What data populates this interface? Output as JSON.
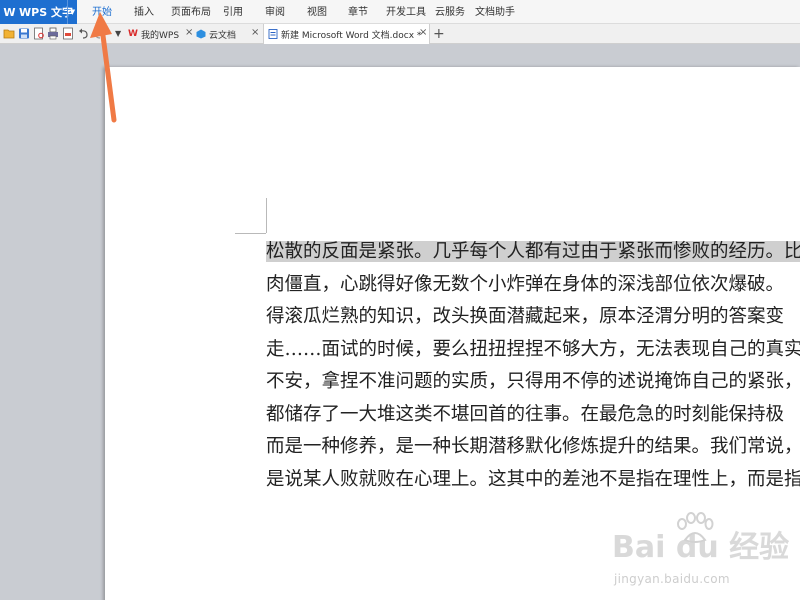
{
  "app": {
    "title": "WPS 文字",
    "logo": "W"
  },
  "menu": {
    "items": [
      "开始",
      "插入",
      "页面布局",
      "引用",
      "审阅",
      "视图",
      "章节",
      "开发工具",
      "云服务",
      "文档助手"
    ],
    "active_index": 0
  },
  "quick_access_icons": [
    "open-icon",
    "save-icon",
    "print-preview-icon",
    "print-icon",
    "export-pdf-icon",
    "undo-icon",
    "redo-icon",
    "dropdown-icon"
  ],
  "tabs": [
    {
      "label": "我的WPS",
      "icon": "wps-icon"
    },
    {
      "label": "云文档",
      "icon": "cloud-doc-icon"
    },
    {
      "label": "新建 Microsoft Word 文档.docx *",
      "icon": "word-doc-icon",
      "active": true
    }
  ],
  "new_tab_symbol": "+",
  "close_symbol": "×",
  "document": {
    "lines": [
      "松散的反面是紧张。几乎每个人都有过由于紧张而惨败的经历。比",
      "肉僵直，心跳得好像无数个小炸弹在身体的深浅部位依次爆破。",
      "得滚瓜烂熟的知识，改头换面潜藏起来，原本泾渭分明的答案变",
      "走……面试的时候，要么扭扭捏捏不够大方，无法表现自己的真实",
      "不安，拿捏不准问题的实质，只得用不停的述说掩饰自己的紧张，",
      "都储存了一大堆这类不堪回首的往事。在最危急的时刻能保持极",
      "而是一种修养，是一种长期潜移默化修炼提升的结果。我们常说，",
      "是说某人败就败在心理上。这其中的差池不是指在理性上，而是指"
    ],
    "highlighted_line_index": 0
  },
  "watermark": {
    "brand": "Bai du 经验",
    "url": "jingyan.baidu.com"
  },
  "colors": {
    "accent": "#1e6fd0",
    "arrow": "#f07a45",
    "selection": "#cfcfcf"
  }
}
